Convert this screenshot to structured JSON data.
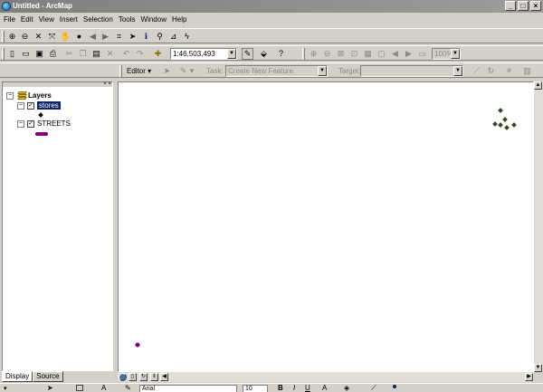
{
  "window": {
    "title": "Untitled - ArcMap"
  },
  "menu": [
    "File",
    "Edit",
    "View",
    "Insert",
    "Selection",
    "Tools",
    "Window",
    "Help"
  ],
  "tools": {
    "scale": "1:46,503,493",
    "zoom_level": "100%"
  },
  "editor": {
    "label": "Editor",
    "task_label": "Task:",
    "task_value": "Create New Feature",
    "target_label": "Target:",
    "target_value": ""
  },
  "toc": {
    "root": "Layers",
    "layers": [
      {
        "name": "stores",
        "checked": true,
        "selected": true,
        "symbol": "point",
        "symbol_color": "#000000"
      },
      {
        "name": "STREETS",
        "checked": true,
        "selected": false,
        "symbol": "line",
        "symbol_color": "#800080"
      }
    ]
  },
  "tabs": [
    "Display",
    "Source"
  ],
  "statusbar": {
    "font": "Arial",
    "size": "10"
  },
  "colors": {
    "store_point": "#2d4a1d",
    "street_point": "#800080",
    "selection": "#0a246a"
  }
}
